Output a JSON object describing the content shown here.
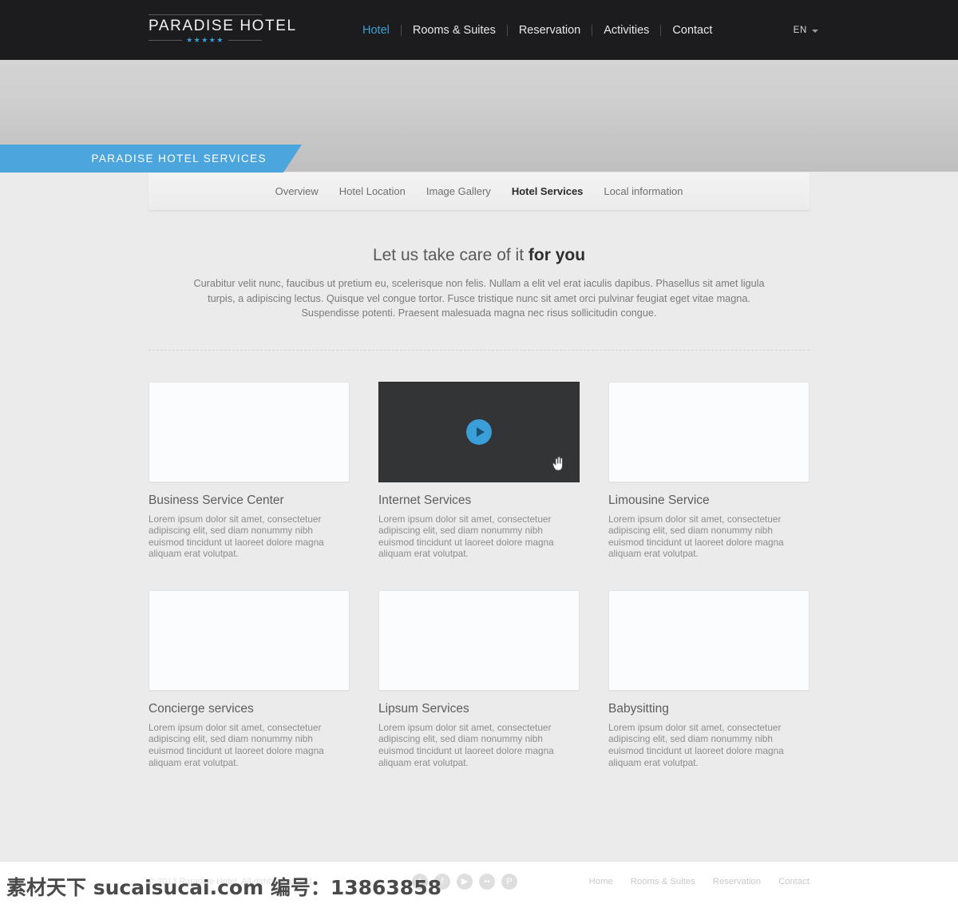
{
  "header": {
    "logo": {
      "name": "PARADISE HOTEL",
      "stars": "★★★★★"
    },
    "nav": [
      {
        "label": "Hotel",
        "active": true
      },
      {
        "label": "Rooms & Suites",
        "active": false
      },
      {
        "label": "Reservation",
        "active": false
      },
      {
        "label": "Activities",
        "active": false
      },
      {
        "label": "Contact",
        "active": false
      }
    ],
    "language": "EN",
    "bg_color": "#1c1c1e",
    "accent_color": "#3a9fd8"
  },
  "hero": {
    "ribbon_label": "PARADISE HOTEL SERVICES",
    "ribbon_color": "#4ca6dd"
  },
  "subnav": [
    {
      "label": "Overview",
      "active": false
    },
    {
      "label": "Hotel Location",
      "active": false
    },
    {
      "label": "Image Gallery",
      "active": false
    },
    {
      "label": "Hotel Services",
      "active": true
    },
    {
      "label": "Local information",
      "active": false
    }
  ],
  "main": {
    "headline_normal": "Let us take care of it ",
    "headline_bold": "for you",
    "intro": "Curabitur velit nunc, faucibus ut pretium eu, scelerisque non felis. Nullam a elit vel erat iaculis dapibus. Phasellus sit amet ligula turpis, a adipiscing lectus. Quisque vel congue tortor. Fusce tristique nunc sit amet orci pulvinar feugiat eget vitae magna. Suspendisse potenti. Praesent malesuada magna nec risus sollicitudin congue.",
    "body_text": "Lorem ipsum dolor sit amet, consectetuer adipiscing elit, sed diam nonummy nibh euismod tincidunt ut laoreet dolore magna aliquam erat volutpat.",
    "cards": [
      {
        "title": "Business Service Center",
        "media": "image"
      },
      {
        "title": "Internet Services",
        "media": "video"
      },
      {
        "title": "Limousine Service",
        "media": "image"
      },
      {
        "title": "Concierge services",
        "media": "image"
      },
      {
        "title": "Lipsum Services",
        "media": "image"
      },
      {
        "title": "Babysitting",
        "media": "image"
      }
    ]
  },
  "footer": {
    "copyright": "© 2013 Paradise Hotel. All rights reserved.",
    "social": [
      {
        "name": "twitter-icon",
        "glyph": "t"
      },
      {
        "name": "facebook-icon",
        "glyph": "f"
      },
      {
        "name": "youtube-icon",
        "glyph": "▶"
      },
      {
        "name": "flickr-icon",
        "glyph": "••"
      },
      {
        "name": "pinterest-icon",
        "glyph": "P"
      }
    ],
    "links": [
      "Home",
      "Rooms & Suites",
      "Reservation",
      "Contact"
    ]
  },
  "watermark": "素材天下 sucaisucai.com 编号：13863858"
}
